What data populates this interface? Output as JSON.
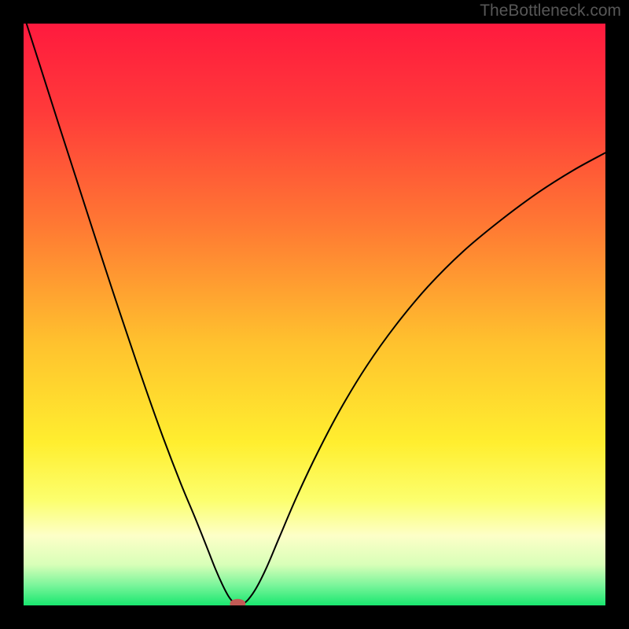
{
  "attribution": "TheBottleneck.com",
  "chart_data": {
    "type": "line",
    "title": "",
    "xlabel": "",
    "ylabel": "",
    "xlim": [
      0,
      1
    ],
    "ylim": [
      0,
      1
    ],
    "gradient_stops": [
      {
        "offset": 0.0,
        "color": "#ff1a3e"
      },
      {
        "offset": 0.15,
        "color": "#ff3a3a"
      },
      {
        "offset": 0.35,
        "color": "#ff7a33"
      },
      {
        "offset": 0.55,
        "color": "#ffc22e"
      },
      {
        "offset": 0.72,
        "color": "#ffee2f"
      },
      {
        "offset": 0.82,
        "color": "#fcff6e"
      },
      {
        "offset": 0.88,
        "color": "#fdffc8"
      },
      {
        "offset": 0.93,
        "color": "#d8ffb8"
      },
      {
        "offset": 0.965,
        "color": "#7bf59b"
      },
      {
        "offset": 1.0,
        "color": "#19e76f"
      }
    ],
    "series": [
      {
        "name": "curve",
        "stroke": "#000000",
        "stroke_width": 2,
        "points": [
          {
            "x": 0.005,
            "y": 1.0
          },
          {
            "x": 0.03,
            "y": 0.922
          },
          {
            "x": 0.06,
            "y": 0.828
          },
          {
            "x": 0.09,
            "y": 0.735
          },
          {
            "x": 0.12,
            "y": 0.642
          },
          {
            "x": 0.15,
            "y": 0.55
          },
          {
            "x": 0.18,
            "y": 0.46
          },
          {
            "x": 0.21,
            "y": 0.372
          },
          {
            "x": 0.24,
            "y": 0.288
          },
          {
            "x": 0.27,
            "y": 0.21
          },
          {
            "x": 0.295,
            "y": 0.15
          },
          {
            "x": 0.315,
            "y": 0.1
          },
          {
            "x": 0.33,
            "y": 0.062
          },
          {
            "x": 0.342,
            "y": 0.035
          },
          {
            "x": 0.352,
            "y": 0.016
          },
          {
            "x": 0.36,
            "y": 0.006
          },
          {
            "x": 0.368,
            "y": 0.001
          },
          {
            "x": 0.376,
            "y": 0.002
          },
          {
            "x": 0.386,
            "y": 0.01
          },
          {
            "x": 0.4,
            "y": 0.03
          },
          {
            "x": 0.418,
            "y": 0.066
          },
          {
            "x": 0.44,
            "y": 0.118
          },
          {
            "x": 0.47,
            "y": 0.188
          },
          {
            "x": 0.505,
            "y": 0.262
          },
          {
            "x": 0.545,
            "y": 0.338
          },
          {
            "x": 0.59,
            "y": 0.412
          },
          {
            "x": 0.64,
            "y": 0.482
          },
          {
            "x": 0.695,
            "y": 0.548
          },
          {
            "x": 0.755,
            "y": 0.608
          },
          {
            "x": 0.82,
            "y": 0.662
          },
          {
            "x": 0.885,
            "y": 0.71
          },
          {
            "x": 0.945,
            "y": 0.748
          },
          {
            "x": 1.0,
            "y": 0.778
          }
        ]
      }
    ],
    "marker": {
      "name": "optimal-point",
      "x": 0.368,
      "y": 0.003,
      "rx": 10,
      "ry": 6,
      "fill": "#c25a55"
    }
  }
}
